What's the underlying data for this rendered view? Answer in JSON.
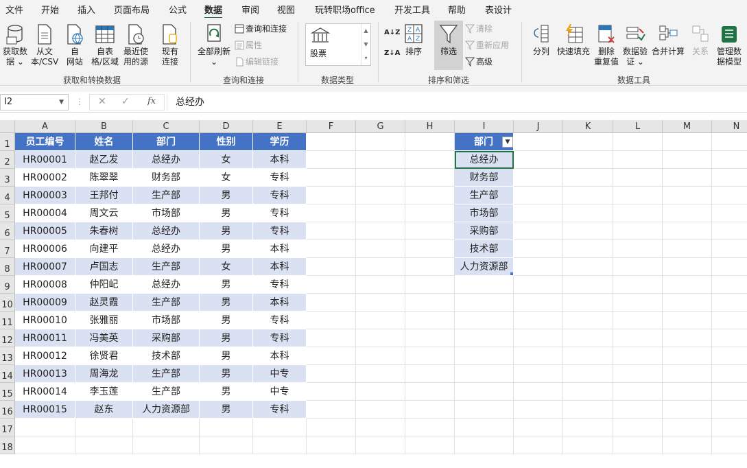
{
  "menu": [
    "文件",
    "开始",
    "插入",
    "页面布局",
    "公式",
    "数据",
    "审阅",
    "视图",
    "玩转职场office",
    "开发工具",
    "帮助",
    "表设计"
  ],
  "menu_active": "数据",
  "ribbon": {
    "get_data": "获取数\n据 ⌄",
    "from_text": "从文\n本/CSV",
    "from_web": "自\n网站",
    "from_table": "自表\n格/区域",
    "recent": "最近使\n用的源",
    "existing": "现有\n连接",
    "group1": "获取和转换数据",
    "refresh_all": "全部刷新\n⌄",
    "queries_conn": "查询和连接",
    "properties": "属性",
    "edit_links": "编辑链接",
    "group2": "查询和连接",
    "stocks": "股票",
    "group3": "数据类型",
    "sort_az": "A↓Z",
    "sort_za": "Z↓A",
    "sort": "排序",
    "filter": "筛选",
    "clear": "清除",
    "reapply": "重新应用",
    "advanced": "高级",
    "group4": "排序和筛选",
    "split": "分列",
    "flash_fill": "快速填充",
    "remove_dup": "删除\n重复值",
    "validation": "数据验\n证 ⌄",
    "consolidate": "合并计算",
    "relations": "关系",
    "manage_model": "管理数\n据模型",
    "group5": "数据工具"
  },
  "formula_bar": {
    "name_box": "I2",
    "fx": "fx",
    "value": "总经办"
  },
  "columns": [
    "A",
    "B",
    "C",
    "D",
    "E",
    "F",
    "G",
    "H",
    "I",
    "J",
    "K",
    "L",
    "M",
    "N"
  ],
  "rows": [
    "1",
    "2",
    "3",
    "4",
    "5",
    "6",
    "7",
    "8",
    "9",
    "10",
    "11",
    "12",
    "13",
    "14",
    "15",
    "16",
    "17",
    "18"
  ],
  "table": {
    "headers": [
      "员工编号",
      "姓名",
      "部门",
      "性别",
      "学历"
    ],
    "rows": [
      [
        "HR00001",
        "赵乙发",
        "总经办",
        "女",
        "本科"
      ],
      [
        "HR00002",
        "陈翠翠",
        "财务部",
        "女",
        "专科"
      ],
      [
        "HR00003",
        "王邦付",
        "生产部",
        "男",
        "专科"
      ],
      [
        "HR00004",
        "周文云",
        "市场部",
        "男",
        "专科"
      ],
      [
        "HR00005",
        "朱春树",
        "总经办",
        "男",
        "专科"
      ],
      [
        "HR00006",
        "向建平",
        "总经办",
        "男",
        "本科"
      ],
      [
        "HR00007",
        "卢国志",
        "生产部",
        "女",
        "本科"
      ],
      [
        "HR00008",
        "仲阳屺",
        "总经办",
        "男",
        "专科"
      ],
      [
        "HR00009",
        "赵灵霞",
        "生产部",
        "男",
        "本科"
      ],
      [
        "HR00010",
        "张雅丽",
        "市场部",
        "男",
        "专科"
      ],
      [
        "HR00011",
        "冯美英",
        "采购部",
        "男",
        "专科"
      ],
      [
        "HR00012",
        "徐贤君",
        "技术部",
        "男",
        "本科"
      ],
      [
        "HR00013",
        "周海龙",
        "生产部",
        "男",
        "中专"
      ],
      [
        "HR00014",
        "李玉莲",
        "生产部",
        "男",
        "中专"
      ],
      [
        "HR00015",
        "赵东",
        "人力资源部",
        "男",
        "专科"
      ]
    ]
  },
  "dept_table": {
    "header": "部门",
    "values": [
      "总经办",
      "财务部",
      "生产部",
      "市场部",
      "采购部",
      "技术部",
      "人力资源部"
    ]
  },
  "colors": {
    "header_blue": "#4472c4",
    "band_blue": "#d9e1f2",
    "excel_green": "#217346"
  }
}
